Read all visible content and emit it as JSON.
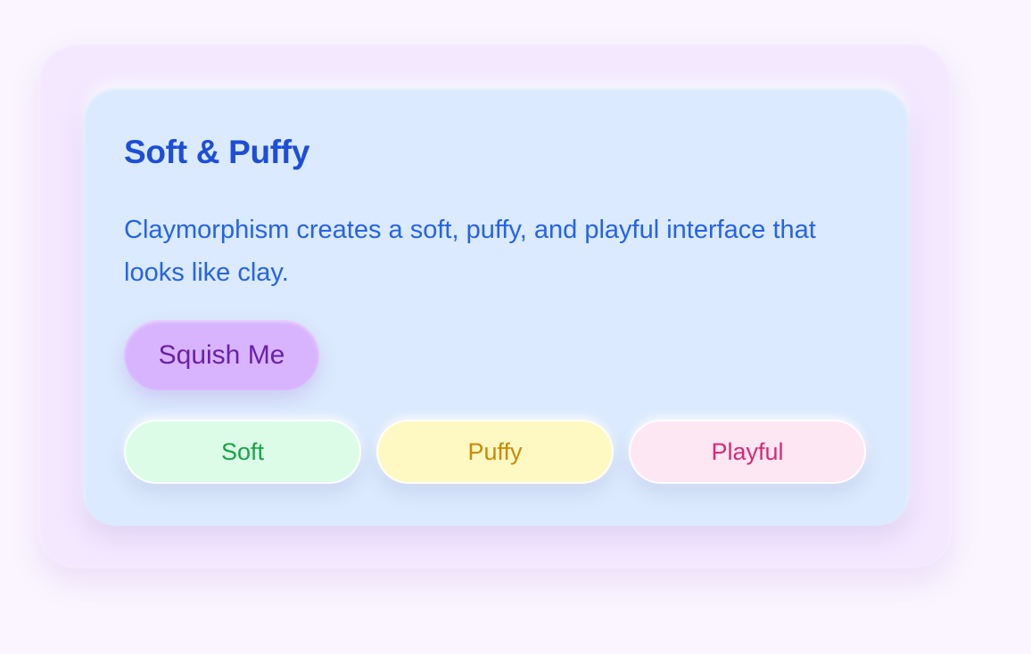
{
  "card": {
    "title": "Soft & Puffy",
    "description": "Claymorphism creates a soft, puffy, and playful interface that looks like clay.",
    "button_label": "Squish Me"
  },
  "chips": [
    {
      "label": "Soft",
      "color": "#16a34a",
      "background": "#dcfce7"
    },
    {
      "label": "Puffy",
      "color": "#ca8a04",
      "background": "#fef9c3"
    },
    {
      "label": "Playful",
      "color": "#db2777",
      "background": "#fce7f3"
    }
  ],
  "colors": {
    "page_background": "#faf5ff",
    "outer_panel": "#f3e8ff",
    "card_background": "#dbeafe",
    "title": "#1d4ed8",
    "text": "#2563eb",
    "button_background": "#d8b4fe",
    "button_text": "#6b21a8"
  }
}
